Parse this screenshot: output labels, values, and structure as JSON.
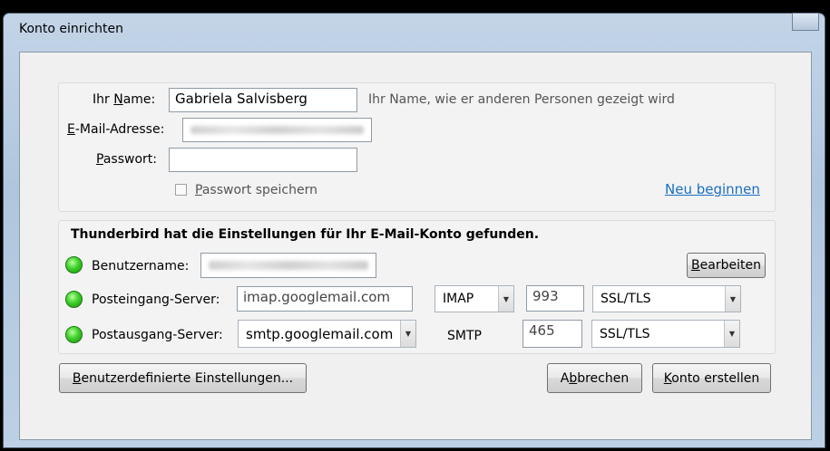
{
  "window": {
    "title": "Konto einrichten"
  },
  "identity": {
    "name_label_pre": "Ihr ",
    "name_label_key": "N",
    "name_label_post": "ame:",
    "name_value": "Gabriela Salvisberg",
    "name_hint": "Ihr Name, wie er anderen Personen gezeigt wird",
    "email_label_key": "E",
    "email_label_post": "-Mail-Adresse:",
    "password_label_key": "P",
    "password_label_post": "asswort:",
    "password_value": "",
    "remember_key": "P",
    "remember_post": "asswort speichern",
    "remember_checked": false,
    "restart_link": "Neu beginnen"
  },
  "result": {
    "heading": "Thunderbird hat die Einstellungen für Ihr E-Mail-Konto gefunden.",
    "username_label": "Benutzername:",
    "edit_button_key": "B",
    "edit_button_post": "earbeiten",
    "incoming_label": "Posteingang-Server:",
    "incoming_server": "imap.googlemail.com",
    "incoming_protocol": "IMAP",
    "incoming_port": "993",
    "incoming_security": "SSL/TLS",
    "outgoing_label": "Postausgang-Server:",
    "outgoing_server": "smtp.googlemail.com",
    "outgoing_protocol": "SMTP",
    "outgoing_port": "465",
    "outgoing_security": "SSL/TLS"
  },
  "buttons": {
    "custom_key": "B",
    "custom_post": "enutzerdefinierte Einstellungen...",
    "cancel_pre": "A",
    "cancel_key": "b",
    "cancel_post": "brechen",
    "create_key": "K",
    "create_post": "onto erstellen"
  },
  "colors": {
    "link": "#1a6fc2",
    "status_ok": "#3ecf2a"
  },
  "icons": {
    "status": "green-status-dot-icon",
    "dropdown": "chevron-down-icon"
  }
}
